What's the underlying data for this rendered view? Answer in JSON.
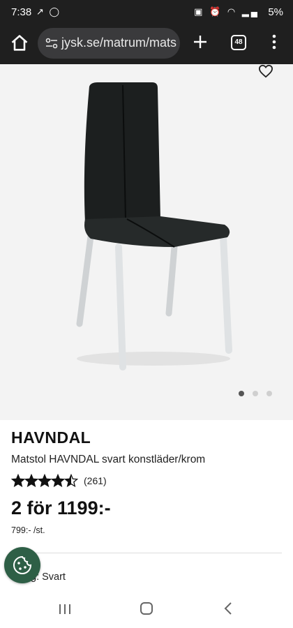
{
  "status_bar": {
    "time": "7:38",
    "left_icons": [
      "signal-arrow-icon",
      "whatsapp-icon"
    ],
    "right_icons": [
      "data-saver-icon",
      "alarm-icon",
      "wifi-icon",
      "cell-signal-icon"
    ],
    "battery": "5%"
  },
  "browser": {
    "url": "jysk.se/matrum/mats",
    "tab_count": "48"
  },
  "product": {
    "name": "HAVNDAL",
    "description": "Matstol HAVNDAL svart konstläder/krom",
    "rating_value": 4.5,
    "rating_max": 5,
    "review_count": "(261)",
    "price": "2 för 1199:-",
    "unit_price": "799:- /st.",
    "color_text": "g: Svart"
  },
  "gallery": {
    "image_count": 3,
    "active_index": 0
  },
  "colors": {
    "statusbar_bg": "#1f1f1f",
    "omnibox_bg": "#3a3a3c",
    "hero_bg": "#f3f3f3",
    "cookie_green": "#2e5f46"
  }
}
